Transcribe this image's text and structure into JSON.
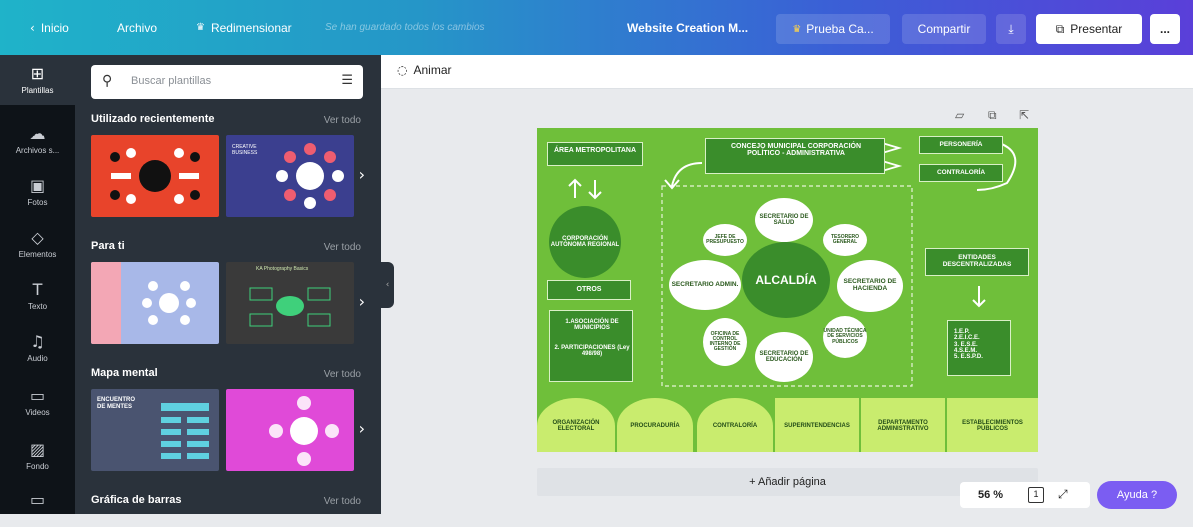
{
  "topbar": {
    "home_label": "Inicio",
    "file_label": "Archivo",
    "resize_label": "Redimensionar",
    "saved_status": "Se han guardado todos los cambios",
    "doc_title": "Website Creation M...",
    "trial_label": "Prueba Ca...",
    "share_label": "Compartir",
    "present_label": "Presentar",
    "more_label": "..."
  },
  "rail": [
    {
      "label": "Plantillas",
      "icon": "template-icon"
    },
    {
      "label": "Archivos s...",
      "icon": "upload-icon"
    },
    {
      "label": "Fotos",
      "icon": "photo-icon"
    },
    {
      "label": "Elementos",
      "icon": "elements-icon"
    },
    {
      "label": "Texto",
      "icon": "text-icon"
    },
    {
      "label": "Audio",
      "icon": "audio-icon"
    },
    {
      "label": "Videos",
      "icon": "video-icon"
    },
    {
      "label": "Fondo",
      "icon": "background-icon"
    },
    {
      "label": "",
      "icon": "folder-icon"
    }
  ],
  "panel": {
    "search_placeholder": "Buscar plantillas",
    "sections": [
      {
        "title": "Utilizado recientemente",
        "link": "Ver todo"
      },
      {
        "title": "Para ti",
        "link": "Ver todo"
      },
      {
        "title": "Mapa mental",
        "link": "Ver todo"
      },
      {
        "title": "Gráfica de barras",
        "link": "Ver todo"
      }
    ],
    "thumb_texts": {
      "creative": "CREATIVE BUSINESS",
      "photo": "KA Photography Basics",
      "encuentro": "ENCUENTRO DE MENTES"
    }
  },
  "editor": {
    "animate_label": "Animar",
    "add_page_label": "+ Añadir página",
    "zoom_value": "56 %",
    "page_count": "1",
    "help_label": "Ayuda ?"
  },
  "design": {
    "area_metro": "ÁREA METROPOLITANA",
    "concejo": "CONCEJO MUNICIPAL CORPORACIÓN POLÍTICO - ADMINISTRATIVA",
    "personeria": "PERSONERÍA",
    "contraloria_top": "CONTRALORÍA",
    "car": "CORPORACIÓN AUTÓNOMA REGIONAL",
    "otros": "OTROS",
    "asociacion": "1.ASOCIACIÓN DE MUNICIPIOS",
    "participaciones": "2. PARTICIPACIONES (Ley 498/98)",
    "alcaldia": "ALCALDÍA",
    "salud": "SECRETARIO DE SALUD",
    "jefe": "JEFE DE PRESUPUESTO",
    "tesorero": "TESORERO GENERAL",
    "admin": "SECRETARIO ADMIN.",
    "hacienda": "SECRETARIO DE HACIENDA",
    "control": "OFICINA DE CONTROL INTERNO DE GESTIÓN",
    "educacion": "SECRETARIO DE EDUCACIÓN",
    "unidad": "UNIDAD TÉCNICA DE SERVICIOS PÚBLICOS",
    "entidades": "ENTIDADES DESCENTRALIZADAS",
    "ent_list": "1.E.P.\n2.E.I.C.E.\n3. E.S.E.\n4.S.E.M.\n5. E.S.P.D.",
    "bottom": [
      "ORGANIZACIÓN ELECTORAL",
      "PROCURADURÍA",
      "CONTRALORÍA",
      "SUPERINTENDENCIAS",
      "DEPARTAMENTO ADMINISTRATIVO",
      "ESTABLECIMIENTOS PÚBLICOS"
    ]
  },
  "colors": {
    "design_green": "#6fbf3a",
    "dark_green": "#3a8d2b",
    "light_green": "#c9ec6e",
    "panel_bg": "#2a323b",
    "help_purple": "#7b5df2"
  }
}
